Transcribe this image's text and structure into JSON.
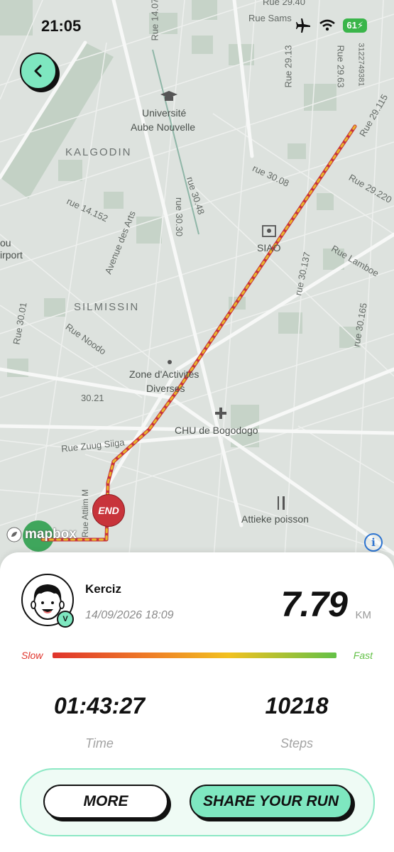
{
  "status_bar": {
    "time": "21:05",
    "battery": "61"
  },
  "map": {
    "streets": [
      "Rue 29.40",
      "Rue Sams",
      "Rue 14.07",
      "Rue 29.13",
      "Rue 29.63",
      "Rue 29.115",
      "3122749381",
      "Rue 29.220",
      "rue 30.08",
      "rue 30.48",
      "rue 30.30",
      "Avenue des Arts",
      "rue 14.152",
      "Rue Lamboe",
      "rue 30.137",
      "rue 30.165",
      "Rue 30.01",
      "Rue Noodo",
      "30.21",
      "Rue Zuug Siiga",
      "Rue Attiim M"
    ],
    "districts": [
      "KALGODIN",
      "SILMISSIN"
    ],
    "pois": [
      "Université",
      "Aube Nouvelle",
      "SIAO",
      "Zone d'Activités",
      "Diverses",
      "CHU de Bogodogo",
      "Attieke poisson",
      "ou",
      "irport"
    ],
    "end_marker": "END",
    "attribution": "mapbox"
  },
  "run": {
    "user": "Kerciz",
    "badge": "V",
    "date": "14/09/2026 18:09",
    "distance": "7.79",
    "distance_unit": "KM",
    "speed_slow": "Slow",
    "speed_fast": "Fast",
    "time": "01:43:27",
    "time_label": "Time",
    "steps": "10218",
    "steps_label": "Steps"
  },
  "actions": {
    "more": "MORE",
    "share": "SHARE YOUR RUN"
  },
  "colors": {
    "accent": "#7ee7c0",
    "route_red": "#c8343b",
    "route_yellow": "#e8b52a",
    "slow": "#e0342c",
    "fast": "#63c147"
  }
}
